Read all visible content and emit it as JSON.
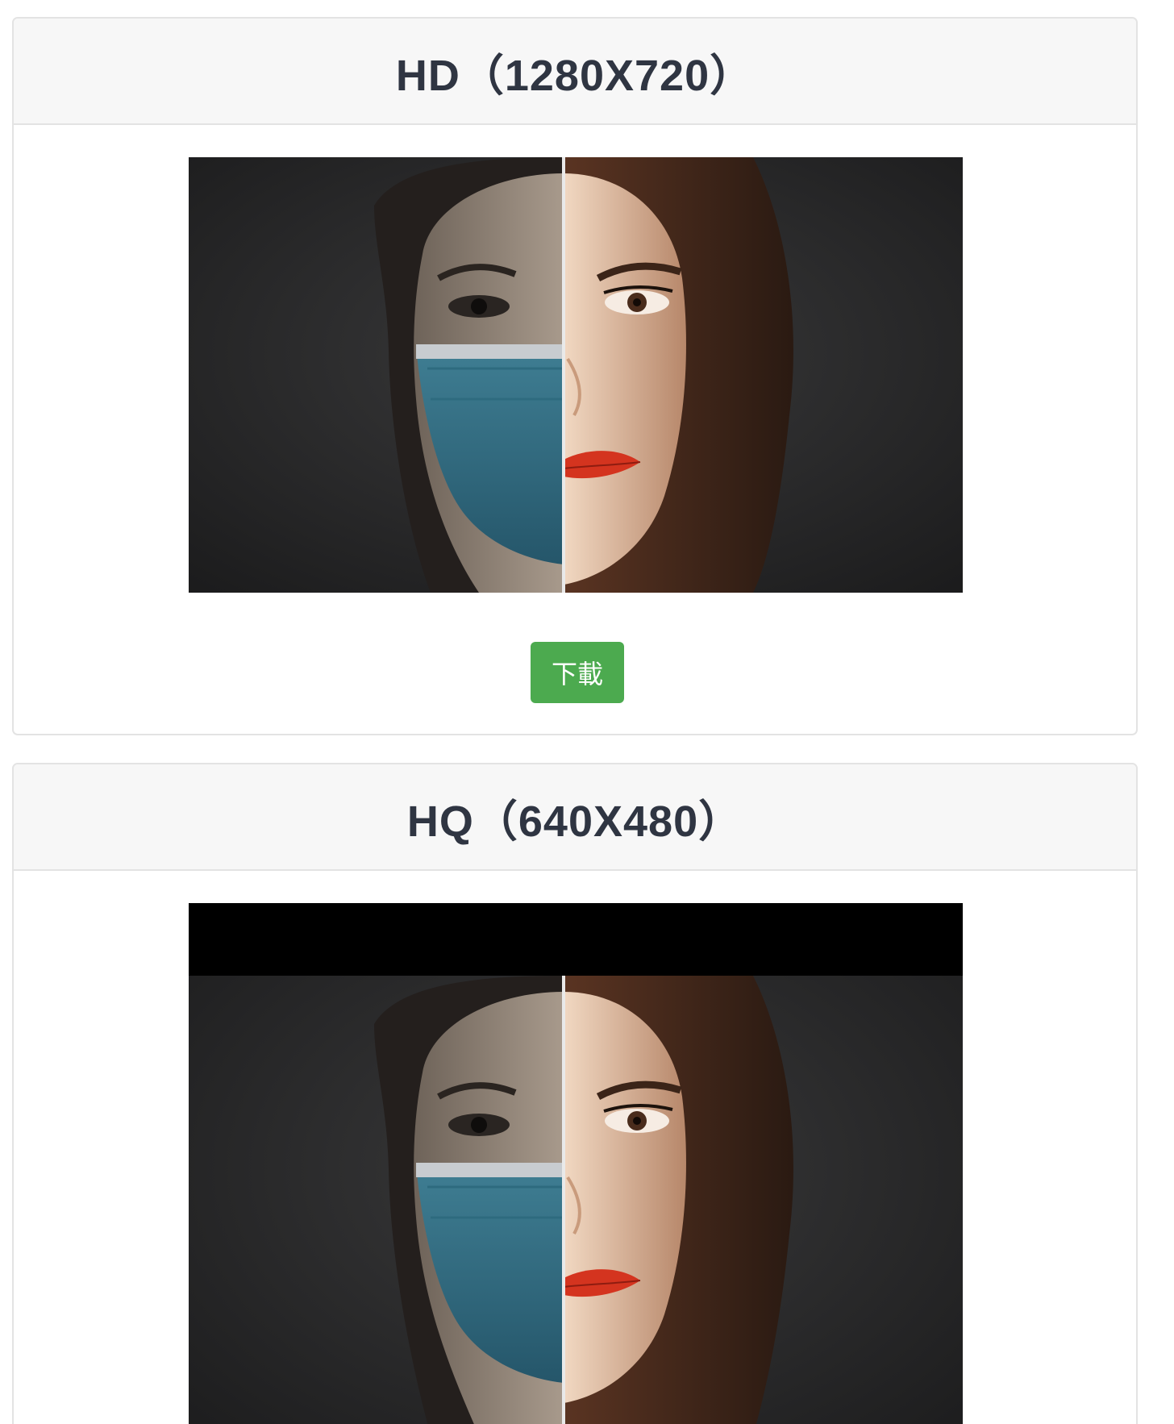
{
  "cards": [
    {
      "title": "HD（1280X720）",
      "image": "thumbnail-image",
      "download_label": "下載"
    },
    {
      "title": "HQ（640X480）",
      "image": "thumbnail-image"
    }
  ],
  "colors": {
    "download_button": "#4caa4f",
    "header_bg": "#f7f7f7",
    "border": "#e3e3e3",
    "title_text": "#2f3542"
  }
}
